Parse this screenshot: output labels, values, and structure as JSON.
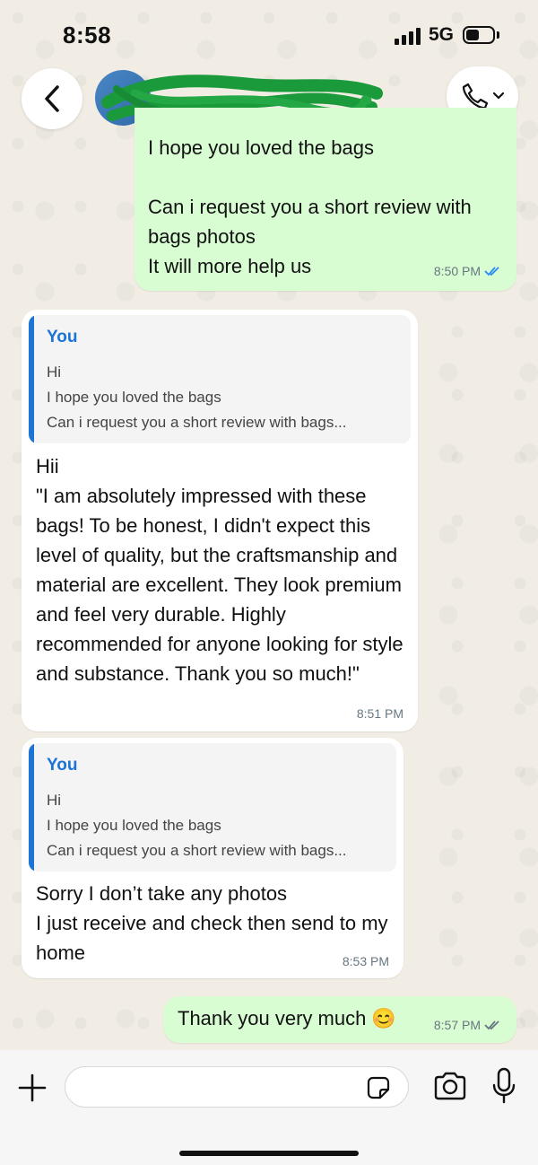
{
  "status_bar": {
    "time": "8:58",
    "network": "5G"
  },
  "header": {
    "contact_name_redacted": true
  },
  "messages": [
    {
      "direction": "out",
      "text": "I hope you loved the bags\n\nCan i request you a short review with bags photos\nIt will more help us",
      "time": "8:50 PM",
      "ticks": "read"
    },
    {
      "direction": "in",
      "quote": {
        "author": "You",
        "lines": [
          "Hi",
          "I hope you loved the bags",
          "Can i request you a short review with bags..."
        ]
      },
      "text": "Hii\n\"I am absolutely impressed with these bags! To be honest, I didn't expect this level of quality, but the craftsmanship and material are excellent. They look premium and feel very durable. Highly recommended for anyone looking for style and substance. Thank you so much!\"",
      "time": "8:51 PM"
    },
    {
      "direction": "in",
      "quote": {
        "author": "You",
        "lines": [
          "Hi",
          "I hope you loved the bags",
          "Can i request you a short review with bags..."
        ]
      },
      "text": "Sorry I don’t take any photos\nI just receive and check then send to my home",
      "time": "8:53 PM"
    },
    {
      "direction": "out",
      "text": "Thank you very much 😊",
      "time": "8:57 PM",
      "ticks": "delivered"
    }
  ],
  "composer": {
    "placeholder": ""
  },
  "colors": {
    "accent_blue": "#1c74d4",
    "outgoing_bubble": "#d9fdd3",
    "incoming_bubble": "#ffffff",
    "read_tick": "#2b8cf0"
  }
}
